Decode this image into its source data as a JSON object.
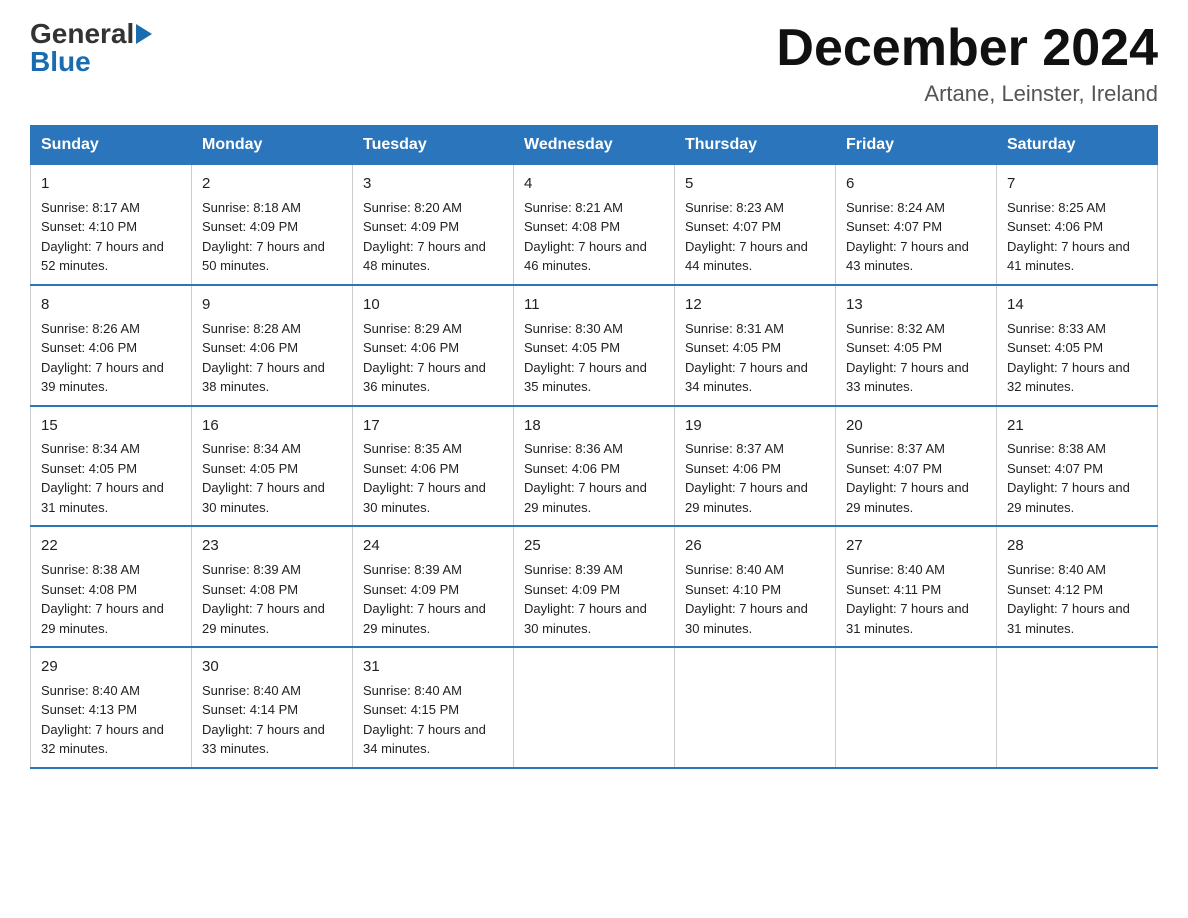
{
  "header": {
    "logo_general": "General",
    "logo_blue": "Blue",
    "title": "December 2024",
    "location": "Artane, Leinster, Ireland"
  },
  "days_of_week": [
    "Sunday",
    "Monday",
    "Tuesday",
    "Wednesday",
    "Thursday",
    "Friday",
    "Saturday"
  ],
  "weeks": [
    [
      {
        "day": "1",
        "sunrise": "Sunrise: 8:17 AM",
        "sunset": "Sunset: 4:10 PM",
        "daylight": "Daylight: 7 hours and 52 minutes."
      },
      {
        "day": "2",
        "sunrise": "Sunrise: 8:18 AM",
        "sunset": "Sunset: 4:09 PM",
        "daylight": "Daylight: 7 hours and 50 minutes."
      },
      {
        "day": "3",
        "sunrise": "Sunrise: 8:20 AM",
        "sunset": "Sunset: 4:09 PM",
        "daylight": "Daylight: 7 hours and 48 minutes."
      },
      {
        "day": "4",
        "sunrise": "Sunrise: 8:21 AM",
        "sunset": "Sunset: 4:08 PM",
        "daylight": "Daylight: 7 hours and 46 minutes."
      },
      {
        "day": "5",
        "sunrise": "Sunrise: 8:23 AM",
        "sunset": "Sunset: 4:07 PM",
        "daylight": "Daylight: 7 hours and 44 minutes."
      },
      {
        "day": "6",
        "sunrise": "Sunrise: 8:24 AM",
        "sunset": "Sunset: 4:07 PM",
        "daylight": "Daylight: 7 hours and 43 minutes."
      },
      {
        "day": "7",
        "sunrise": "Sunrise: 8:25 AM",
        "sunset": "Sunset: 4:06 PM",
        "daylight": "Daylight: 7 hours and 41 minutes."
      }
    ],
    [
      {
        "day": "8",
        "sunrise": "Sunrise: 8:26 AM",
        "sunset": "Sunset: 4:06 PM",
        "daylight": "Daylight: 7 hours and 39 minutes."
      },
      {
        "day": "9",
        "sunrise": "Sunrise: 8:28 AM",
        "sunset": "Sunset: 4:06 PM",
        "daylight": "Daylight: 7 hours and 38 minutes."
      },
      {
        "day": "10",
        "sunrise": "Sunrise: 8:29 AM",
        "sunset": "Sunset: 4:06 PM",
        "daylight": "Daylight: 7 hours and 36 minutes."
      },
      {
        "day": "11",
        "sunrise": "Sunrise: 8:30 AM",
        "sunset": "Sunset: 4:05 PM",
        "daylight": "Daylight: 7 hours and 35 minutes."
      },
      {
        "day": "12",
        "sunrise": "Sunrise: 8:31 AM",
        "sunset": "Sunset: 4:05 PM",
        "daylight": "Daylight: 7 hours and 34 minutes."
      },
      {
        "day": "13",
        "sunrise": "Sunrise: 8:32 AM",
        "sunset": "Sunset: 4:05 PM",
        "daylight": "Daylight: 7 hours and 33 minutes."
      },
      {
        "day": "14",
        "sunrise": "Sunrise: 8:33 AM",
        "sunset": "Sunset: 4:05 PM",
        "daylight": "Daylight: 7 hours and 32 minutes."
      }
    ],
    [
      {
        "day": "15",
        "sunrise": "Sunrise: 8:34 AM",
        "sunset": "Sunset: 4:05 PM",
        "daylight": "Daylight: 7 hours and 31 minutes."
      },
      {
        "day": "16",
        "sunrise": "Sunrise: 8:34 AM",
        "sunset": "Sunset: 4:05 PM",
        "daylight": "Daylight: 7 hours and 30 minutes."
      },
      {
        "day": "17",
        "sunrise": "Sunrise: 8:35 AM",
        "sunset": "Sunset: 4:06 PM",
        "daylight": "Daylight: 7 hours and 30 minutes."
      },
      {
        "day": "18",
        "sunrise": "Sunrise: 8:36 AM",
        "sunset": "Sunset: 4:06 PM",
        "daylight": "Daylight: 7 hours and 29 minutes."
      },
      {
        "day": "19",
        "sunrise": "Sunrise: 8:37 AM",
        "sunset": "Sunset: 4:06 PM",
        "daylight": "Daylight: 7 hours and 29 minutes."
      },
      {
        "day": "20",
        "sunrise": "Sunrise: 8:37 AM",
        "sunset": "Sunset: 4:07 PM",
        "daylight": "Daylight: 7 hours and 29 minutes."
      },
      {
        "day": "21",
        "sunrise": "Sunrise: 8:38 AM",
        "sunset": "Sunset: 4:07 PM",
        "daylight": "Daylight: 7 hours and 29 minutes."
      }
    ],
    [
      {
        "day": "22",
        "sunrise": "Sunrise: 8:38 AM",
        "sunset": "Sunset: 4:08 PM",
        "daylight": "Daylight: 7 hours and 29 minutes."
      },
      {
        "day": "23",
        "sunrise": "Sunrise: 8:39 AM",
        "sunset": "Sunset: 4:08 PM",
        "daylight": "Daylight: 7 hours and 29 minutes."
      },
      {
        "day": "24",
        "sunrise": "Sunrise: 8:39 AM",
        "sunset": "Sunset: 4:09 PM",
        "daylight": "Daylight: 7 hours and 29 minutes."
      },
      {
        "day": "25",
        "sunrise": "Sunrise: 8:39 AM",
        "sunset": "Sunset: 4:09 PM",
        "daylight": "Daylight: 7 hours and 30 minutes."
      },
      {
        "day": "26",
        "sunrise": "Sunrise: 8:40 AM",
        "sunset": "Sunset: 4:10 PM",
        "daylight": "Daylight: 7 hours and 30 minutes."
      },
      {
        "day": "27",
        "sunrise": "Sunrise: 8:40 AM",
        "sunset": "Sunset: 4:11 PM",
        "daylight": "Daylight: 7 hours and 31 minutes."
      },
      {
        "day": "28",
        "sunrise": "Sunrise: 8:40 AM",
        "sunset": "Sunset: 4:12 PM",
        "daylight": "Daylight: 7 hours and 31 minutes."
      }
    ],
    [
      {
        "day": "29",
        "sunrise": "Sunrise: 8:40 AM",
        "sunset": "Sunset: 4:13 PM",
        "daylight": "Daylight: 7 hours and 32 minutes."
      },
      {
        "day": "30",
        "sunrise": "Sunrise: 8:40 AM",
        "sunset": "Sunset: 4:14 PM",
        "daylight": "Daylight: 7 hours and 33 minutes."
      },
      {
        "day": "31",
        "sunrise": "Sunrise: 8:40 AM",
        "sunset": "Sunset: 4:15 PM",
        "daylight": "Daylight: 7 hours and 34 minutes."
      },
      null,
      null,
      null,
      null
    ]
  ]
}
